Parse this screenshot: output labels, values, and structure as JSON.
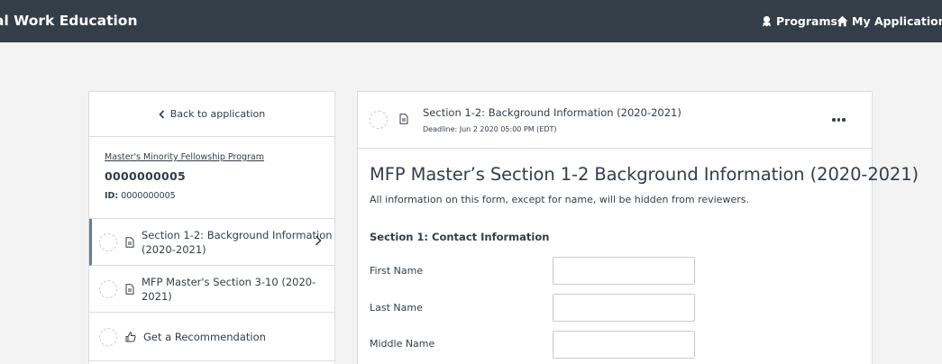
{
  "topbar": {
    "brand": "al Work Education",
    "programs_label": "Programs",
    "applications_label": "My Applications"
  },
  "sidebar": {
    "back_label": "Back to application",
    "program_name": "Master's Minority Fellowship Program",
    "application_number": "0000000005",
    "id_label": "ID:",
    "id_value": "0000000005",
    "tasks": [
      {
        "label": "Section 1-2: Background Information (2020-2021)",
        "icon": "document-icon",
        "active": true
      },
      {
        "label": "MFP Master's Section 3-10 (2020-2021)",
        "icon": "document-icon",
        "active": false
      },
      {
        "label": "Get a Recommendation",
        "icon": "thumbs-up-icon",
        "active": false
      }
    ]
  },
  "main": {
    "task_title": "Section 1-2: Background Information (2020-2021)",
    "deadline": "Deadline: Jun 2 2020 05:00 PM (EDT)",
    "form_title": "MFP Master’s Section 1-2 Background Information (2020-2021)",
    "form_subtitle": "All information on this form, except for name, will be hidden from reviewers.",
    "section_title": "Section 1: Contact Information",
    "fields": [
      {
        "label": "First Name",
        "value": ""
      },
      {
        "label": "Last Name",
        "value": ""
      },
      {
        "label": "Middle Name",
        "value": ""
      }
    ]
  },
  "colors": {
    "topbar": "#333e48",
    "background": "#f3f3f3",
    "border": "#d9dcde",
    "active_indicator": "#6c7d8c"
  }
}
